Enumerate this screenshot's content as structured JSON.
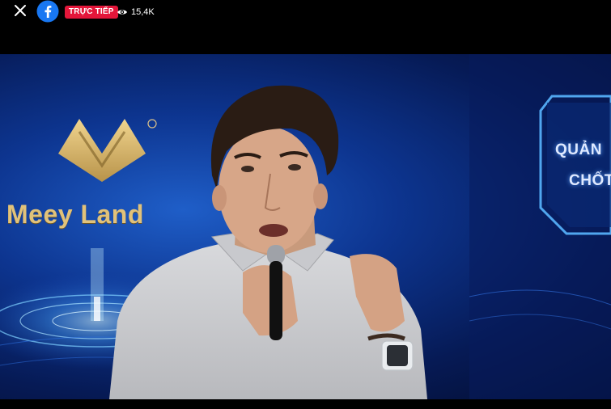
{
  "topbar": {
    "close_icon": "close-icon",
    "facebook_icon": "facebook-logo-icon",
    "live_label": "TRỰC TIẾP",
    "viewer_icon": "eye-icon",
    "viewer_count": "15,4K"
  },
  "video": {
    "brand_name": "Meey Land",
    "registered_mark": "®",
    "panel_line_1": "QUẢN",
    "panel_line_2": "CHỐT",
    "colors": {
      "live_red": "#e4163a",
      "brand_gold": "#e1c27a",
      "stage_blue": "#0d3590"
    }
  }
}
